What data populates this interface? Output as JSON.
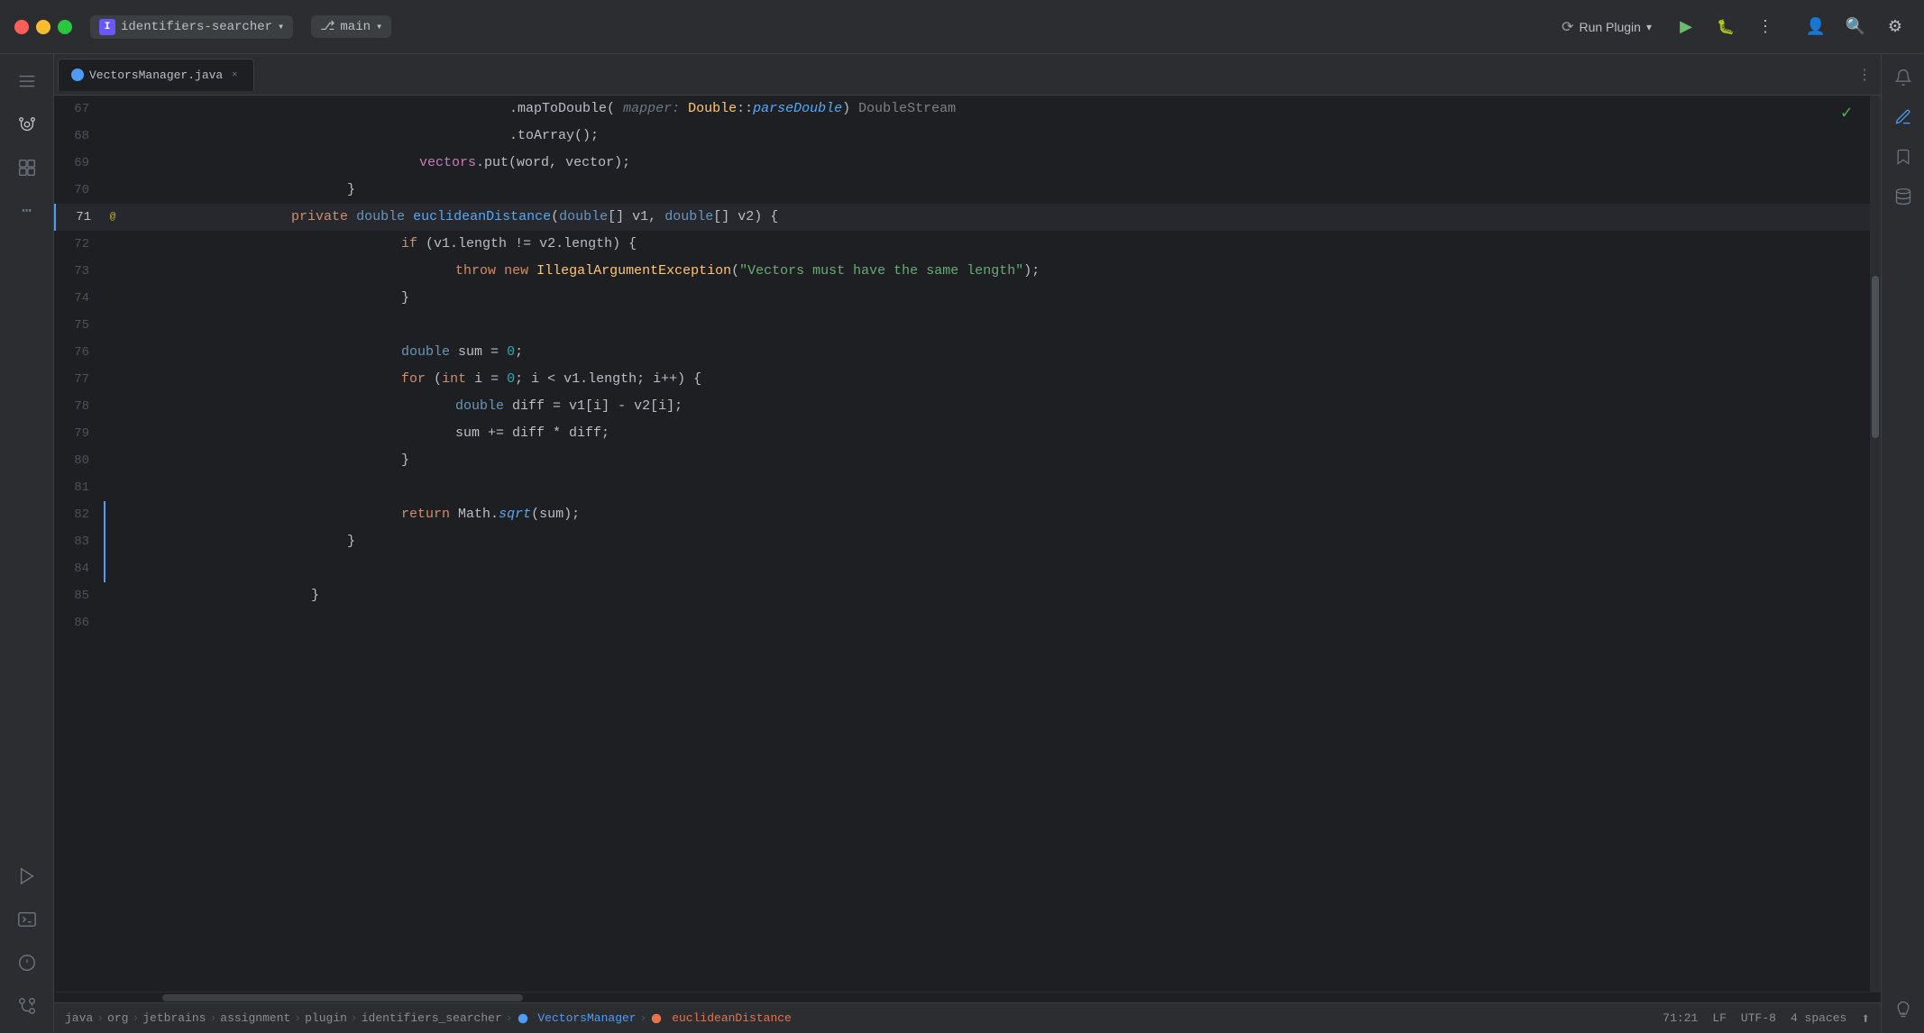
{
  "titlebar": {
    "project_name": "identifiers-searcher",
    "branch_name": "main",
    "run_plugin_label": "Run Plugin",
    "play_icon": "▶",
    "debug_icon": "🐞",
    "more_icon": "⋮",
    "profile_icon": "👤",
    "search_icon": "🔍",
    "settings_icon": "⚙"
  },
  "tab": {
    "filename": "VectorsManager.java",
    "icon_color": "#4e9bf9"
  },
  "code": {
    "lines": [
      {
        "num": 67,
        "content": "mapToDouble",
        "raw": true
      },
      {
        "num": 68,
        "content": ".toArray();",
        "raw": true
      },
      {
        "num": 69,
        "content": "vectors.put(word, vector);",
        "raw": true
      },
      {
        "num": 70,
        "content": "}",
        "raw": true
      },
      {
        "num": 71,
        "content": "private double euclideanDistance(double[] v1, double[] v2) {",
        "raw": true,
        "active": true
      },
      {
        "num": 72,
        "content": "if (v1.length != v2.length) {",
        "raw": true
      },
      {
        "num": 73,
        "content": "throw new IllegalArgumentException(\"Vectors must have the same length\");",
        "raw": true
      },
      {
        "num": 74,
        "content": "}",
        "raw": true
      },
      {
        "num": 75,
        "content": "",
        "raw": true
      },
      {
        "num": 76,
        "content": "double sum = 0;",
        "raw": true
      },
      {
        "num": 77,
        "content": "for (int i = 0; i < v1.length; i++) {",
        "raw": true
      },
      {
        "num": 78,
        "content": "double diff = v1[i] - v2[i];",
        "raw": true
      },
      {
        "num": 79,
        "content": "sum += diff * diff;",
        "raw": true
      },
      {
        "num": 80,
        "content": "}",
        "raw": true
      },
      {
        "num": 81,
        "content": "",
        "raw": true
      },
      {
        "num": 82,
        "content": "return Math.sqrt(sum);",
        "raw": true
      },
      {
        "num": 83,
        "content": "}",
        "raw": true
      },
      {
        "num": 84,
        "content": "",
        "raw": true
      },
      {
        "num": 85,
        "content": "}",
        "raw": true
      },
      {
        "num": 86,
        "content": "",
        "raw": true
      }
    ]
  },
  "statusbar": {
    "breadcrumb": [
      {
        "label": "java",
        "type": "plain"
      },
      {
        "label": ">",
        "type": "sep"
      },
      {
        "label": "org",
        "type": "plain"
      },
      {
        "label": ">",
        "type": "sep"
      },
      {
        "label": "jetbrains",
        "type": "plain"
      },
      {
        "label": ">",
        "type": "sep"
      },
      {
        "label": "assignment",
        "type": "plain"
      },
      {
        "label": ">",
        "type": "sep"
      },
      {
        "label": "plugin",
        "type": "plain"
      },
      {
        "label": ">",
        "type": "sep"
      },
      {
        "label": "identifiers_searcher",
        "type": "plain"
      },
      {
        "label": ">",
        "type": "sep"
      },
      {
        "label": "VectorsManager",
        "type": "class"
      },
      {
        "label": ">",
        "type": "sep"
      },
      {
        "label": "euclideanDistance",
        "type": "method"
      }
    ],
    "position": "71:21",
    "line_ending": "LF",
    "encoding": "UTF-8",
    "indent": "4 spaces"
  }
}
